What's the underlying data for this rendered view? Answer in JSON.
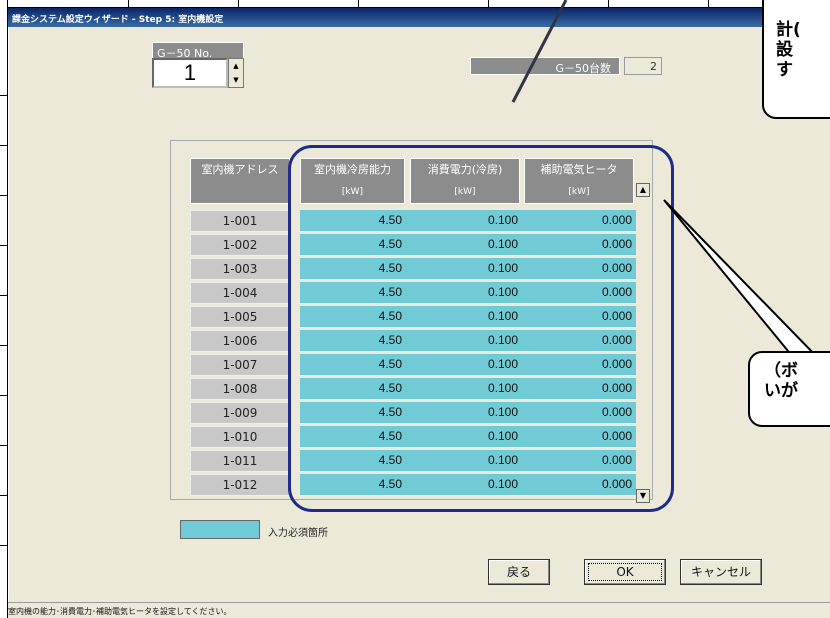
{
  "window": {
    "title": "課金システム設定ウィザード - Step 5: 室内機設定"
  },
  "g50": {
    "label": "G－50 No.",
    "value": "1",
    "count_label": "G－50台数",
    "count_value": "2"
  },
  "columns": [
    {
      "label": "室内機アドレス",
      "unit": ""
    },
    {
      "label": "室内機冷房能力",
      "unit": "[kW]"
    },
    {
      "label": "消費電力(冷房)",
      "unit": "[kW]"
    },
    {
      "label": "補助電気ヒータ",
      "unit": "[kW]"
    }
  ],
  "rows": [
    [
      "1-001",
      "4.50",
      "0.100",
      "0.000"
    ],
    [
      "1-002",
      "4.50",
      "0.100",
      "0.000"
    ],
    [
      "1-003",
      "4.50",
      "0.100",
      "0.000"
    ],
    [
      "1-004",
      "4.50",
      "0.100",
      "0.000"
    ],
    [
      "1-005",
      "4.50",
      "0.100",
      "0.000"
    ],
    [
      "1-006",
      "4.50",
      "0.100",
      "0.000"
    ],
    [
      "1-007",
      "4.50",
      "0.100",
      "0.000"
    ],
    [
      "1-008",
      "4.50",
      "0.100",
      "0.000"
    ],
    [
      "1-009",
      "4.50",
      "0.100",
      "0.000"
    ],
    [
      "1-010",
      "4.50",
      "0.100",
      "0.000"
    ],
    [
      "1-011",
      "4.50",
      "0.100",
      "0.000"
    ],
    [
      "1-012",
      "4.50",
      "0.100",
      "0.000"
    ]
  ],
  "legend": {
    "text": "入力必須箇所",
    "color": "#71cbd6"
  },
  "buttons": {
    "back": "戻る",
    "ok": "OK",
    "cancel": "キャンセル"
  },
  "status": "室内機の能力･消費電力･補助電気ヒータを設定してください。",
  "callout_top": {
    "lines": [
      "計(",
      "設",
      "す"
    ]
  },
  "callout_bottom": {
    "lines": [
      "（ボ",
      "いが"
    ]
  },
  "accent": {
    "highlight": "#1e2a8c",
    "required": "#71cbd6"
  }
}
